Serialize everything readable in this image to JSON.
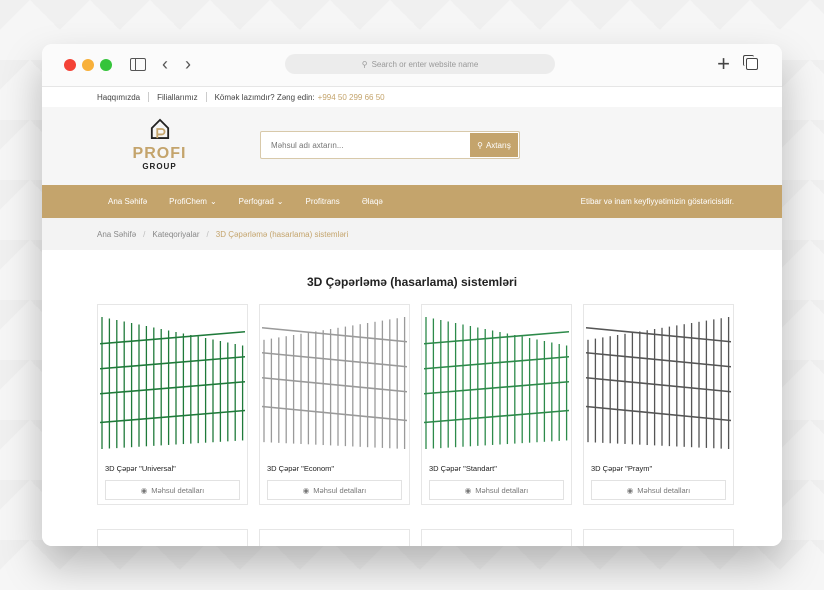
{
  "browser": {
    "address_placeholder": "Search or enter website name"
  },
  "topbar": {
    "links": [
      "Haqqımızda",
      "Filiallarımız"
    ],
    "help": "Kömək lazımdır? Zəng edin:",
    "phone": "+994 50 299 66 50"
  },
  "logo": {
    "line1": "PROFI",
    "line2": "GROUP"
  },
  "search": {
    "placeholder": "Məhsul adı axtarın...",
    "button": "Axtarış"
  },
  "menu": {
    "items": [
      "Ana Səhifə",
      "ProfiChem",
      "Perfograd",
      "Profitrans",
      "Əlaqə"
    ],
    "tagline": "Etibar və inam keyfiyyətimizin göstəricisidir."
  },
  "breadcrumb": [
    "Ana Səhifə",
    "Kateqoriyalar",
    "3D Çəpərləmə (hasarlama) sistemləri"
  ],
  "page": {
    "title": "3D Çəpərləmə (hasarlama) sistemləri"
  },
  "products": [
    {
      "name": "3D Çəpər \"Universal\"",
      "button": "Məhsul detalları",
      "color": "#1f7a3a"
    },
    {
      "name": "3D Çəpər \"Econom\"",
      "button": "Məhsul detalları",
      "color": "#9a9a9a"
    },
    {
      "name": "3D Çəpər \"Standart\"",
      "button": "Məhsul detalları",
      "color": "#2d8a4a"
    },
    {
      "name": "3D Çəpər \"Praym\"",
      "button": "Məhsul detalları",
      "color": "#555555"
    }
  ],
  "colors": {
    "accent": "#c4a46c"
  }
}
